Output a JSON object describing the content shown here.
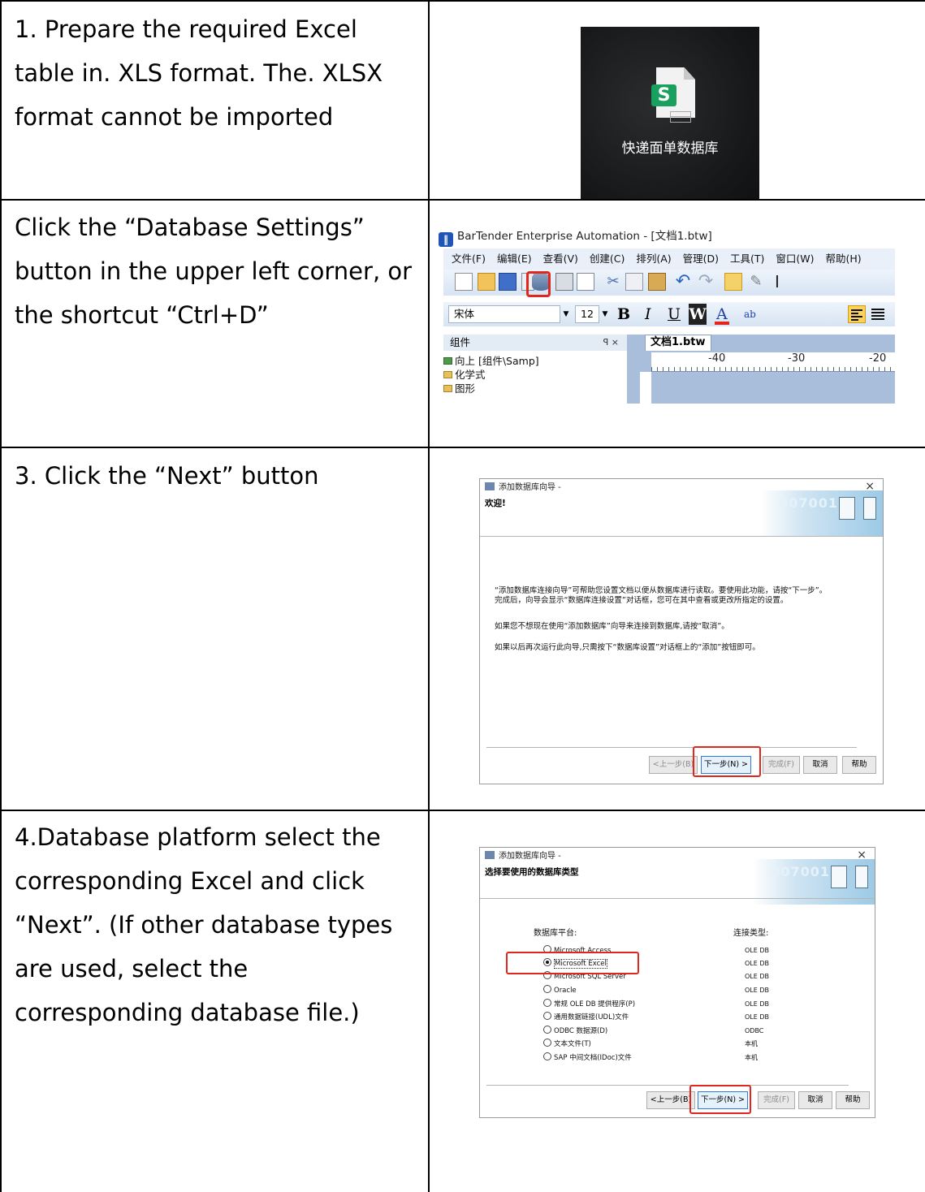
{
  "steps": [
    {
      "text": "1.  Prepare the required Excel table in. XLS format. The. XLSX format cannot be imported",
      "image": {
        "file_icon": "spreadsheet-file-icon",
        "badge": "S",
        "label": "快递面单数据库"
      }
    },
    {
      "text": "Click the “Database Settings” button in the upper left corner, or the shortcut “Ctrl+D”",
      "image": {
        "window_title": "BarTender Enterprise Automation - [文档1.btw]",
        "menu": [
          "文件(F)",
          "编辑(E)",
          "查看(V)",
          "创建(C)",
          "排列(A)",
          "管理(D)",
          "工具(T)",
          "窗口(W)",
          "帮助(H)"
        ],
        "font_name": "宋体",
        "font_size": "12",
        "format_buttons": [
          "B",
          "I",
          "U",
          "W",
          "A",
          "ab"
        ],
        "panel_title": "组件",
        "panel_controls": "ꟼ ×",
        "tree": [
          "向上 [组件\\Samp]",
          "化学式",
          "图形"
        ],
        "doc_tab": "文档1.btw",
        "ruler_labels": [
          "-40",
          "-30",
          "-20"
        ],
        "highlight_color": "#e0261d"
      }
    },
    {
      "text": "3. Click the “Next” button",
      "image": {
        "title": "添加数据库向导 -",
        "heading": "欢迎!",
        "close": "×",
        "banner_text": "007001",
        "paragraphs": [
          "“添加数据库连接向导”可帮助您设置文档以便从数据库进行读取。要使用此功能，请按“下一步”。完成后，向导会显示“数据库连接设置”对话框，您可在其中查看或更改所指定的设置。",
          "如果您不想现在使用“添加数据库”向导来连接到数据库,请按“取消”。",
          "如果以后再次运行此向导,只需按下“数据库设置”对话框上的“添加”按钮即可。"
        ],
        "buttons": {
          "back": "<上一步(B)",
          "next": "下一步(N) >",
          "finish": "完成(F)",
          "cancel": "取消",
          "help": "帮助"
        }
      }
    },
    {
      "text": "4.Database platform select the corresponding Excel and click “Next”.   (If other database types are used, select the corresponding database file.)",
      "image": {
        "title": "添加数据库向导 -",
        "heading": "选择要使用的数据库类型",
        "close": "×",
        "banner_text": "007001",
        "platform_label": "数据库平台:",
        "connection_label": "连接类型:",
        "options": [
          {
            "platform": "Microsoft Access",
            "connection": "OLE DB",
            "selected": false
          },
          {
            "platform": "Microsoft Excel",
            "connection": "OLE DB",
            "selected": true
          },
          {
            "platform": "Microsoft SQL Server",
            "connection": "OLE DB",
            "selected": false
          },
          {
            "platform": "Oracle",
            "connection": "OLE DB",
            "selected": false
          },
          {
            "platform": "常规 OLE DB 提供程序(P)",
            "connection": "OLE DB",
            "selected": false
          },
          {
            "platform": "通用数据链接(UDL)文件",
            "connection": "OLE DB",
            "selected": false
          },
          {
            "platform": "ODBC 数据源(D)",
            "connection": "ODBC",
            "selected": false
          },
          {
            "platform": "文本文件(T)",
            "connection": "本机",
            "selected": false
          },
          {
            "platform": "SAP 中间文档(IDoc)文件",
            "connection": "本机",
            "selected": false
          }
        ],
        "buttons": {
          "back": "<上一步(B)",
          "next": "下一步(N) >",
          "finish": "完成(F)",
          "cancel": "取消",
          "help": "帮助"
        }
      }
    }
  ]
}
